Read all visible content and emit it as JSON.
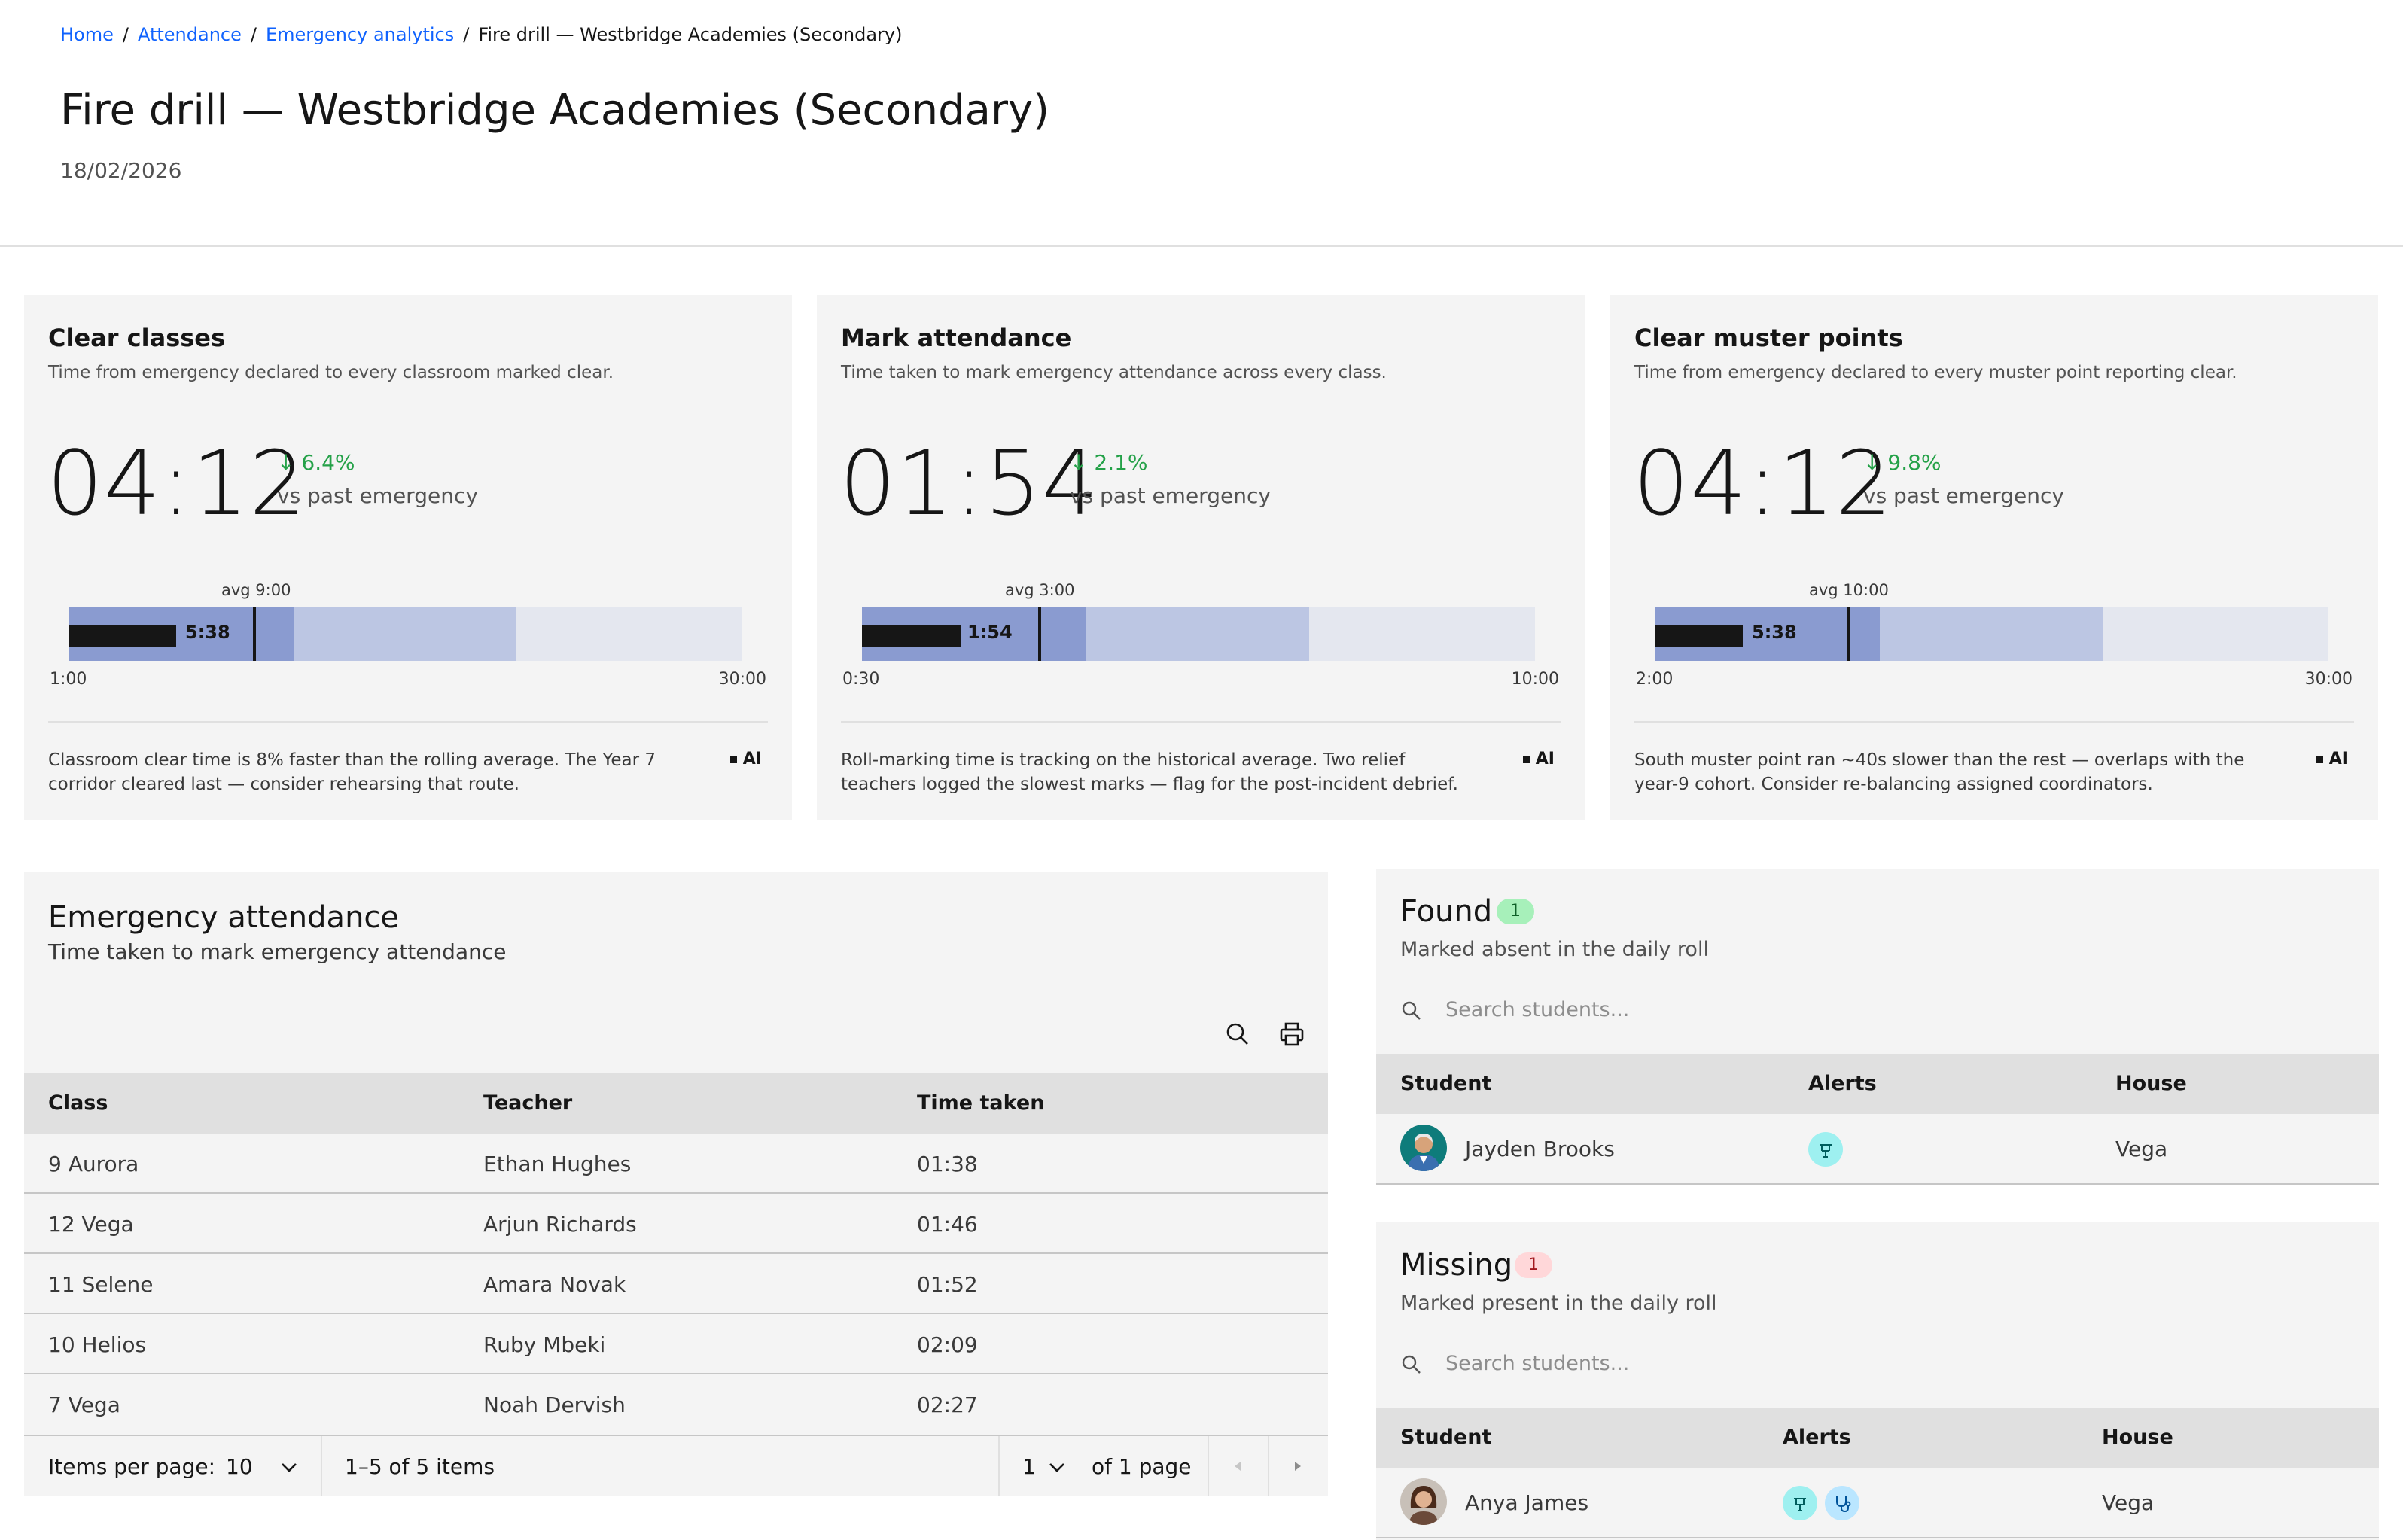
{
  "breadcrumb": {
    "items": [
      "Home",
      "Attendance",
      "Emergency analytics"
    ],
    "separator": "/",
    "current": "Fire drill — Westbridge Academies (Secondary)"
  },
  "page": {
    "title": "Fire drill — Westbridge Academies (Secondary)",
    "date": "18/02/2026"
  },
  "metrics": [
    {
      "title": "Clear classes",
      "desc": "Time from emergency declared to every classroom marked clear.",
      "value": "04:12",
      "delta": "6.4%",
      "delta_direction": "down",
      "vs": "vs past emergency",
      "bar_current": "5:38",
      "bar_avg": "avg 9:00",
      "axis_min": "1:00",
      "axis_max": "30:00",
      "insight": "Classroom clear time is 8% faster than the rolling average. The Year 7 corridor cleared last — consider rehearsing that route.",
      "ai": "AI"
    },
    {
      "title": "Mark attendance",
      "desc": "Time taken to mark emergency attendance across every class.",
      "value": "01:54",
      "delta": "2.1%",
      "delta_direction": "down",
      "vs": "vs past emergency",
      "bar_current": "1:54",
      "bar_avg": "avg 3:00",
      "axis_min": "0:30",
      "axis_max": "10:00",
      "insight": "Roll-marking time is tracking on the historical average. Two relief teachers logged the slowest marks — flag for the post-incident debrief.",
      "ai": "AI"
    },
    {
      "title": "Clear muster points",
      "desc": "Time from emergency declared to every muster point reporting clear.",
      "value": "04:12",
      "delta": "9.8%",
      "delta_direction": "down",
      "vs": "vs past emergency",
      "bar_current": "5:38",
      "bar_avg": "avg 10:00",
      "axis_min": "2:00",
      "axis_max": "30:00",
      "insight": "South muster point ran ~40s slower than the rest — overlaps with the year-9 cohort. Consider re-balancing assigned coordinators.",
      "ai": "AI"
    }
  ],
  "attendance": {
    "title": "Emergency attendance",
    "subtitle": "Time taken to mark emergency attendance",
    "columns": [
      "Class",
      "Teacher",
      "Time taken"
    ],
    "rows": [
      [
        "9 Aurora",
        "Ethan Hughes",
        "01:38"
      ],
      [
        "12 Vega",
        "Arjun Richards",
        "01:46"
      ],
      [
        "11 Selene",
        "Amara Novak",
        "01:52"
      ],
      [
        "10 Helios",
        "Ruby Mbeki",
        "02:09"
      ],
      [
        "7 Vega",
        "Noah Dervish",
        "02:27"
      ]
    ],
    "pager": {
      "items_per_page_label": "Items per page:",
      "items_per_page": "10",
      "range": "1–5 of 5 items",
      "page": "1",
      "of_pages": "of 1 page"
    }
  },
  "found": {
    "title": "Found",
    "count": "1",
    "subtitle": "Marked absent in the daily roll",
    "search_placeholder": "Search students...",
    "columns": [
      "Student",
      "Alerts",
      "House"
    ],
    "rows": [
      {
        "name": "Jayden Brooks",
        "alerts": [
          "medical-alert-icon"
        ],
        "house": "Vega"
      }
    ]
  },
  "missing": {
    "title": "Missing",
    "count": "1",
    "subtitle": "Marked present in the daily roll",
    "search_placeholder": "Search students...",
    "columns": [
      "Student",
      "Alerts",
      "House"
    ],
    "rows": [
      {
        "name": "Anya James",
        "alerts": [
          "medical-alert-icon",
          "stethoscope-icon"
        ],
        "house": "Vega"
      }
    ]
  },
  "colors": {
    "link": "#0f62fe",
    "positive": "#24a148",
    "card_bg": "#f4f4f4",
    "bar_light": "#e4e7ef",
    "bar_mid": "#bcc6e3",
    "bar_dark": "#8a9bd0",
    "found_badge": "#a7f0ba",
    "missing_badge": "#ffd7d9",
    "alert_bg": "#9ef0f0"
  }
}
